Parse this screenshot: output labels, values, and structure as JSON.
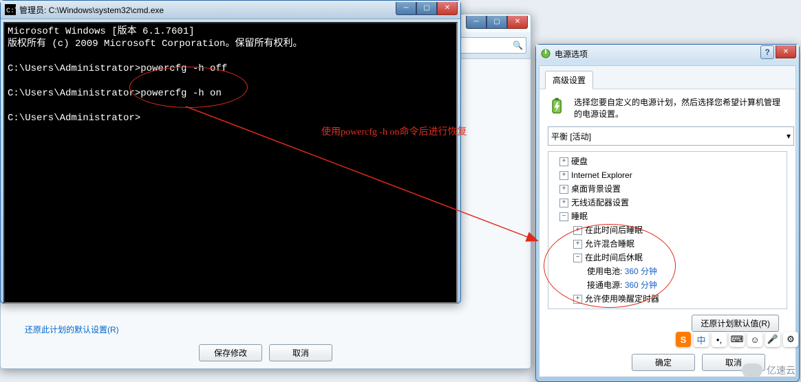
{
  "cmd": {
    "title": "管理员: C:\\Windows\\system32\\cmd.exe",
    "lines": [
      "Microsoft Windows [版本 6.1.7601]",
      "版权所有 (c) 2009 Microsoft Corporation。保留所有权利。",
      "",
      "C:\\Users\\Administrator>powercfg -h off",
      "",
      "C:\\Users\\Administrator>powercfg -h on",
      "",
      "C:\\Users\\Administrator>"
    ],
    "annotation": "使用powercfg -h on命令后进行恢复"
  },
  "back": {
    "restore_link": "还原此计划的默认设置(R)",
    "save_btn": "保存修改",
    "cancel_btn": "取消"
  },
  "power": {
    "title": "电源选项",
    "tab": "高级设置",
    "info": "选择您要自定义的电源计划，然后选择您希望计算机管理的电源设置。",
    "plan": "平衡 [活动]",
    "tree": {
      "n1": "硬盘",
      "n2": "Internet Explorer",
      "n3": "桌面背景设置",
      "n4": "无线适配器设置",
      "n5": "睡眠",
      "n5a": "在此时间后睡眠",
      "n5b": "允许混合睡眠",
      "n5c": "在此时间后休眠",
      "n5c1_label": "使用电池:",
      "n5c1_val": "360 分钟",
      "n5c2_label": "接通电源:",
      "n5c2_val": "360 分钟",
      "n6": "允许使用唤醒定时器"
    },
    "restore_btn": "还原计划默认值(R)",
    "ok": "确定",
    "cancel": "取消"
  },
  "brand": "亿速云",
  "glyph": {
    "min": "─",
    "max": "▢",
    "x": "✕",
    "left": "◀",
    "right": "▶",
    "down": "▾",
    "q": "?",
    "plus": "+",
    "minus": "−",
    "search": "🔍"
  }
}
